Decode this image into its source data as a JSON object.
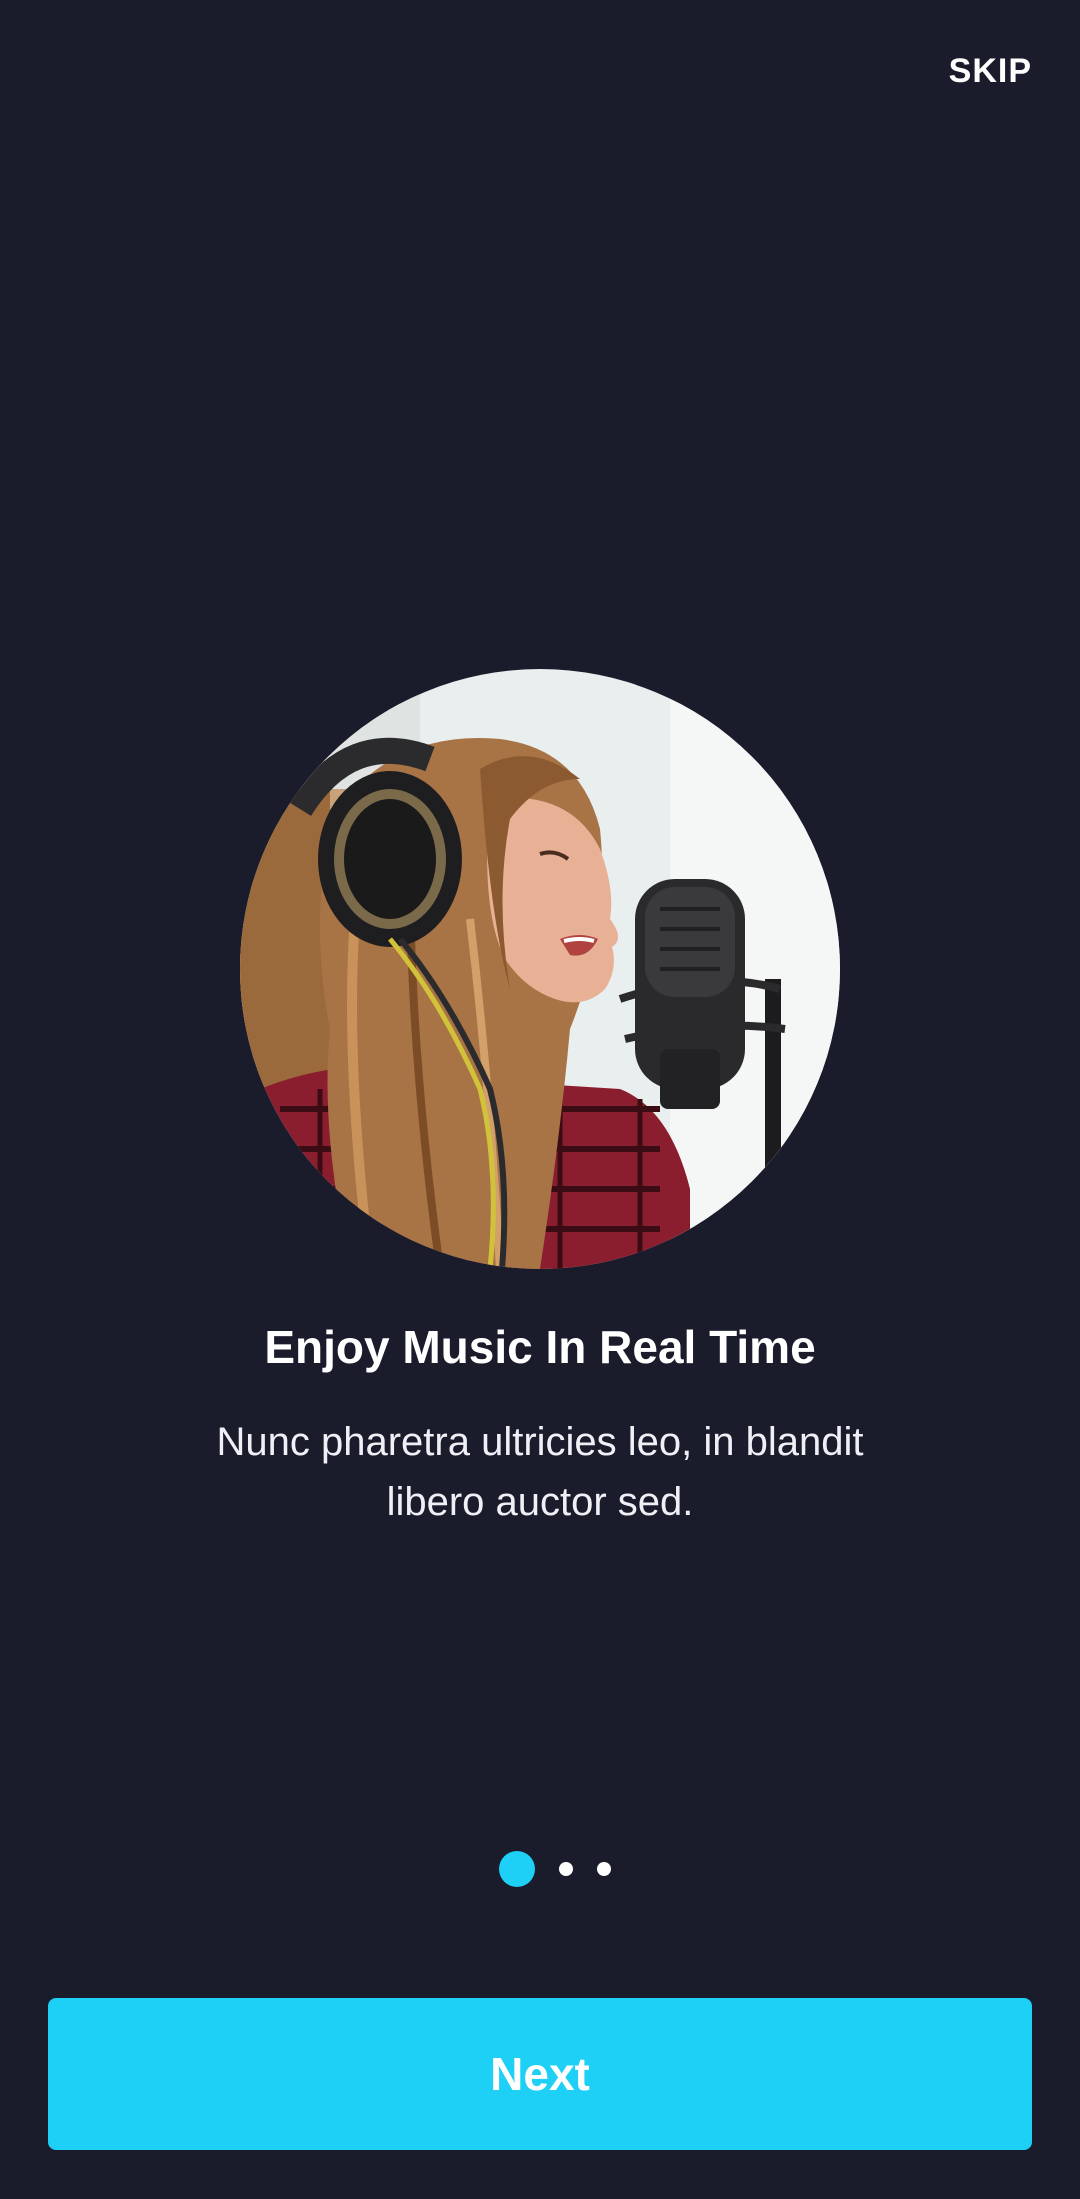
{
  "header": {
    "skip_label": "SKIP"
  },
  "onboarding": {
    "hero_image": "woman-singing-into-microphone-with-headphones",
    "title": "Enjoy Music In Real Time",
    "description": "Nunc pharetra ultricies leo, in blandit libero auctor sed.",
    "page_indicator": {
      "current": 1,
      "total": 3
    }
  },
  "footer": {
    "next_label": "Next"
  },
  "colors": {
    "background": "#1a1b2b",
    "accent": "#1ecff6",
    "text": "#ffffff"
  }
}
